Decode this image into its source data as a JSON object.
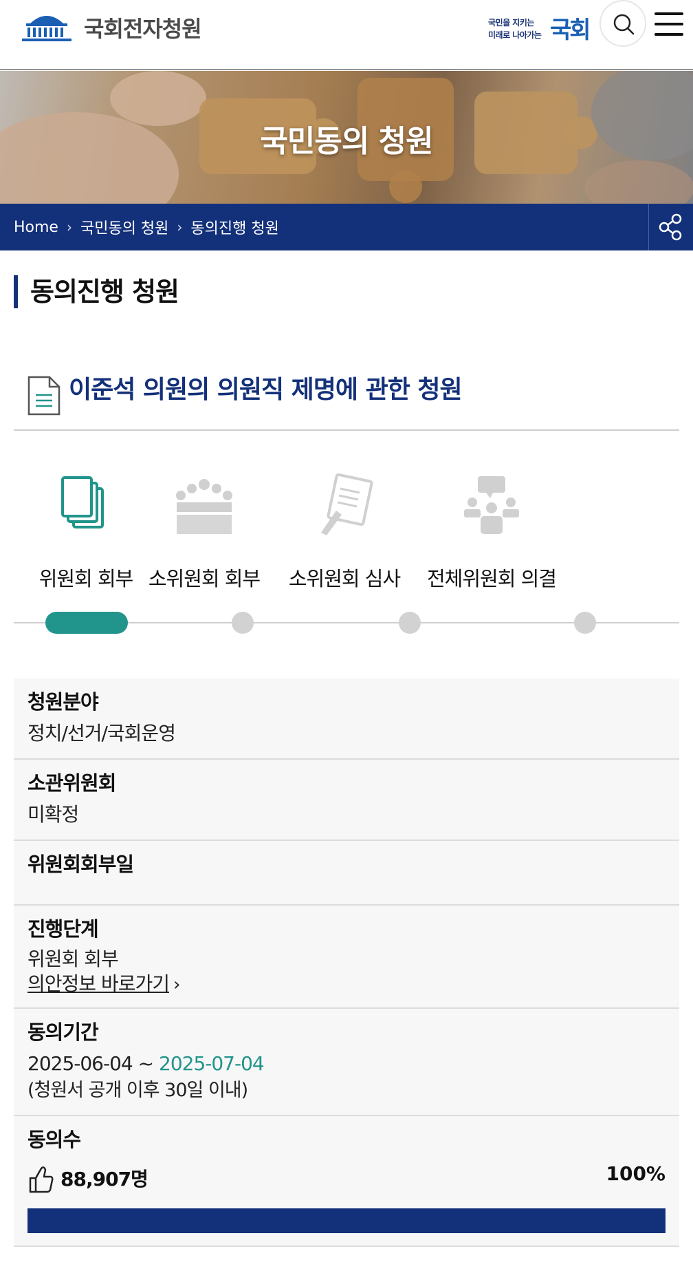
{
  "header": {
    "site_name": "국회전자청원",
    "slogan_line1": "국민을 지키는",
    "slogan_line2": "미래로 나아가는",
    "slogan_emblem": "국회",
    "search_icon": "search-icon",
    "menu_icon": "hamburger-menu-icon"
  },
  "hero": {
    "title": "국민동의 청원"
  },
  "breadcrumb": {
    "items": [
      "Home",
      "국민동의 청원",
      "동의진행 청원"
    ],
    "share_icon": "share-icon"
  },
  "page_title": "동의진행 청원",
  "petition": {
    "title": "이준석 의원의 의원직 제명에 관한 청원"
  },
  "steps": [
    {
      "label": "위원회 회부",
      "icon": "documents-icon",
      "active": true
    },
    {
      "label": "소위원회 회부",
      "icon": "meeting-table-icon",
      "active": false
    },
    {
      "label": "소위원회 심사",
      "icon": "review-pen-icon",
      "active": false
    },
    {
      "label": "전체위원회 의결",
      "icon": "committee-discussion-icon",
      "active": false
    }
  ],
  "info": {
    "field": {
      "label": "청원분야",
      "value": "정치/선거/국회운영"
    },
    "committee": {
      "label": "소관위원회",
      "value": "미확정"
    },
    "referral_date": {
      "label": "위원회회부일",
      "value": ""
    },
    "stage": {
      "label": "진행단계",
      "value": "위원회 회부",
      "link": "의안정보 바로가기"
    },
    "period": {
      "label": "동의기간",
      "start": "2025-06-04",
      "sep": " ~ ",
      "end": "2025-07-04",
      "note": "(청원서 공개 이후 30일 이내)"
    },
    "agree": {
      "label": "동의수",
      "count": "88,907명",
      "percent": "100%",
      "progress": 1.0
    }
  },
  "colors": {
    "navy": "#13307a",
    "teal": "#21948b",
    "inactive_gray": "#d2d2d2"
  }
}
